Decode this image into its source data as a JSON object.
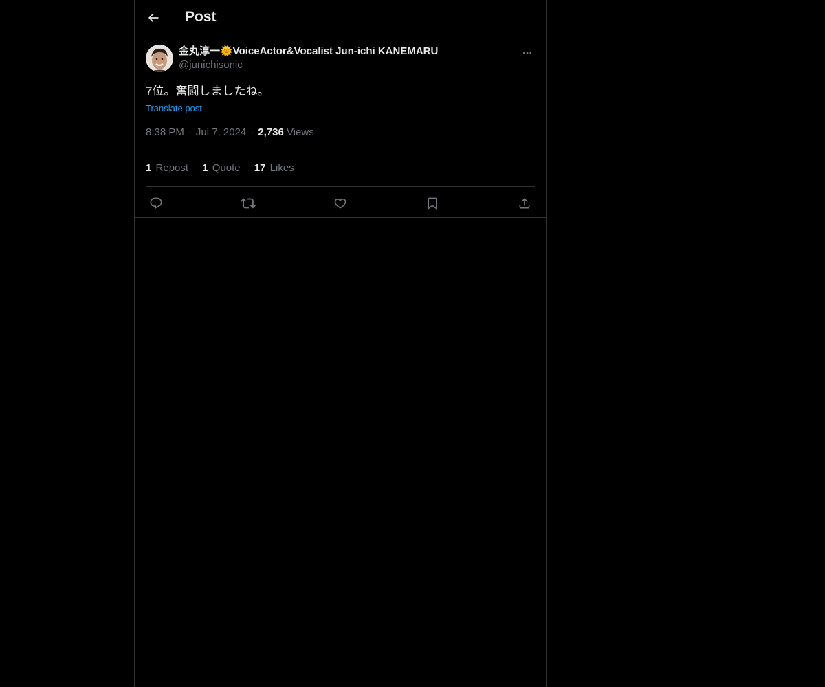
{
  "header": {
    "title": "Post",
    "back_icon": "arrow-left-icon"
  },
  "post": {
    "author": {
      "display_name": "金丸淳一🌞VoiceActor&Vocalist Jun-ichi KANEMARU",
      "handle": "@junichisonic"
    },
    "text": "7位。奮闘しましたね。",
    "translate_label": "Translate post",
    "time": "8:38 PM",
    "date": "Jul 7, 2024",
    "views_count": "2,736",
    "views_label": "Views",
    "stats": {
      "reposts_count": "1",
      "reposts_label": "Repost",
      "quotes_count": "1",
      "quotes_label": "Quote",
      "likes_count": "17",
      "likes_label": "Likes"
    },
    "actions": [
      "reply-icon",
      "repost-icon",
      "like-icon",
      "bookmark-icon",
      "share-icon"
    ]
  },
  "colors": {
    "background": "#000000",
    "text": "#e7e9ea",
    "muted": "#71767b",
    "accent": "#1d9bf0",
    "border": "#2f3336"
  }
}
